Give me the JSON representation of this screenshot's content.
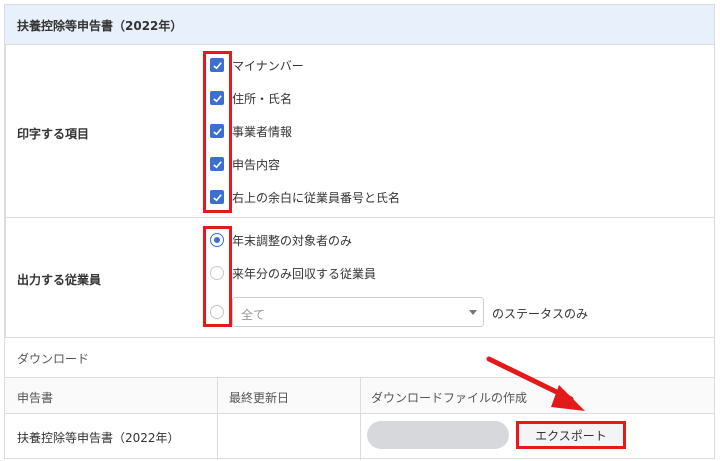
{
  "header": {
    "title": "扶養控除等申告書（2022年）"
  },
  "print_items": {
    "label": "印字する項目",
    "options": [
      {
        "label": "マイナンバー",
        "checked": true
      },
      {
        "label": "住所・氏名",
        "checked": true
      },
      {
        "label": "事業者情報",
        "checked": true
      },
      {
        "label": "申告内容",
        "checked": true
      },
      {
        "label": "右上の余白に従業員番号と氏名",
        "checked": true
      }
    ]
  },
  "employees": {
    "label": "出力する従業員",
    "options": [
      {
        "label": "年末調整の対象者のみ",
        "selected": true
      },
      {
        "label": "来年分のみ回収する従業員",
        "selected": false
      }
    ],
    "status_select": {
      "value": "全て"
    },
    "status_suffix": "のステータスのみ"
  },
  "download": {
    "title": "ダウンロード",
    "columns": [
      "申告書",
      "最終更新日",
      "ダウンロードファイルの作成"
    ],
    "row": {
      "document": "扶養控除等申告書（2022年）",
      "last_updated": "",
      "progress": 0,
      "export_label": "エクスポート"
    }
  },
  "colors": {
    "accent": "#3b6fd1",
    "highlight": "#e41a1a",
    "header_bg": "#e8f0fb"
  }
}
